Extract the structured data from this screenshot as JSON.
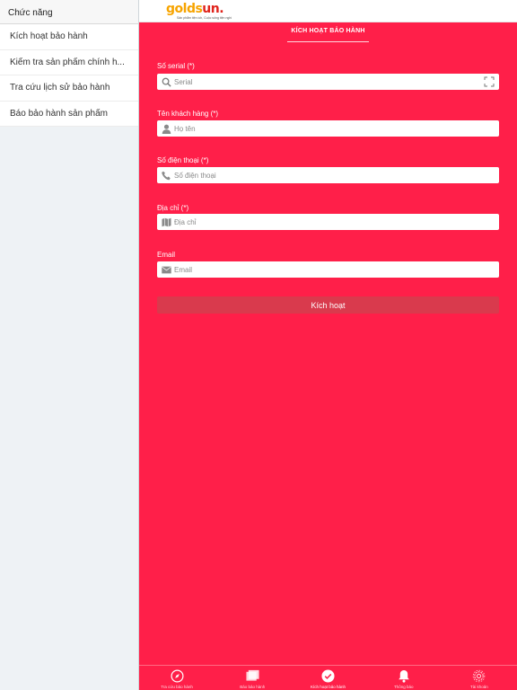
{
  "sidebar": {
    "title": "Chức năng",
    "items": [
      {
        "label": "Kích hoạt bảo hành"
      },
      {
        "label": "Kiểm tra sản phẩm chính h..."
      },
      {
        "label": "Tra cứu lịch sử bảo hành"
      },
      {
        "label": "Báo bảo hành sản phẩm"
      }
    ]
  },
  "header": {
    "logo_main": "golds",
    "logo_accent": "un",
    "logo_tagline": "Sản phẩm tiện ích, Cuộc sống tiện nghi"
  },
  "section_title": "KÍCH HOẠT BẢO HÀNH",
  "form": {
    "serial": {
      "label": "Số serial (*)",
      "placeholder": "Serial",
      "value": ""
    },
    "name": {
      "label": "Tên khách hàng (*)",
      "placeholder": "Họ tên",
      "value": ""
    },
    "phone": {
      "label": "Số điện thoại (*)",
      "placeholder": "Số điện thoại",
      "value": ""
    },
    "address": {
      "label": "Địa chỉ (*)",
      "placeholder": "Địa chỉ",
      "value": ""
    },
    "email": {
      "label": "Email",
      "placeholder": "Email",
      "value": ""
    },
    "submit_label": "Kích hoạt"
  },
  "bottom_nav": {
    "items": [
      {
        "label": "Tra cứu bảo hành",
        "icon": "compass-icon"
      },
      {
        "label": "Báo bảo hành",
        "icon": "folder-icon"
      },
      {
        "label": "Kích hoạt bảo hành",
        "icon": "check-circle-icon",
        "active": true
      },
      {
        "label": "Thông báo",
        "icon": "bell-icon"
      },
      {
        "label": "Tài khoản",
        "icon": "gear-icon"
      }
    ]
  },
  "colors": {
    "primary": "#ff1f49",
    "button": "#d93a4d",
    "sidebar_bg": "#eef2f5",
    "logo_orange": "#f7a400",
    "logo_red": "#e0241c"
  }
}
